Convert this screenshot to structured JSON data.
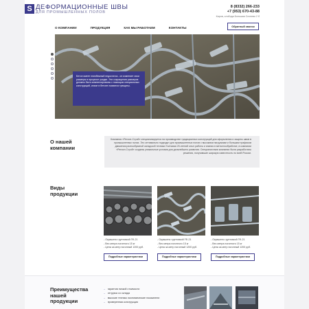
{
  "header": {
    "logo_letter": "S",
    "logo_title": "Деформационные швы",
    "logo_subtitle": "для промышленных полов",
    "phone_1": "8 (8332) 266-233",
    "phone_2": "+7 (953) 670-43-88",
    "address": "Киров, слобода Большая Сочнево 2 б"
  },
  "nav": {
    "items": [
      "О КОМПАНИИ",
      "ПРОДУКЦИЯ",
      "КАК МЫ РАБОТАЕМ",
      "КОНТАКТЫ"
    ],
    "callback_label": "Обратный звонок"
  },
  "hero": {
    "slides_count": 6,
    "active_slide": 1,
    "caption": "Бетон имеет неизбежный недостаток - он изменяет свои размеры в процессе усадки. Эти сокращения размеров должны быть компенсированы с помощью специальных конструкций, иначе в бетоне появятся трещины."
  },
  "about": {
    "title": "О нашей компании",
    "text": "Компания «Регион-Строй» специализируется на производстве традиционных конструкций для оформления и защиты швов в промышленных полах. Это оптимально подходит для промышленных полов с высокими нагрузками и большим трафиком движения разнообразной складской техники.Учитывая 20-летний опыт работы и знания в металлообработке, в компании «Регион-Строй» созданы уникальные условия для дальнейшего развития. Специалистами компании были разработаны решения, получившие широкую известность по всей России."
  },
  "products": {
    "title": "Виды продукции",
    "button_label": "Подробные характеристики",
    "items": [
      {
        "lines": [
          "- Окрашено грунтовкой ГФ-21",
          "- Вес метра погонного 15 кг",
          "- Цена за метр погонный 1200 руб."
        ]
      },
      {
        "lines": [
          "- Окрашено грунтовкой ГФ-21",
          "- Вес метра погонного 15 кг",
          "- Цена за метр погонный 1200 руб."
        ]
      },
      {
        "lines": [
          "- Окрашено грунтовкой ГФ-21",
          "- Вес метра погонного 15 кг",
          "- Цена за метр погонный 1200 руб."
        ]
      }
    ]
  },
  "advantages": {
    "title": "Преимущества нашей продукции",
    "items": [
      "гарантия низкой стоимости",
      "отгрузка со склада",
      "высокие технико экономические показатели",
      "проверенная конструкция"
    ]
  },
  "colors": {
    "accent": "#3b3a8c",
    "about_bg": "#ededef"
  }
}
